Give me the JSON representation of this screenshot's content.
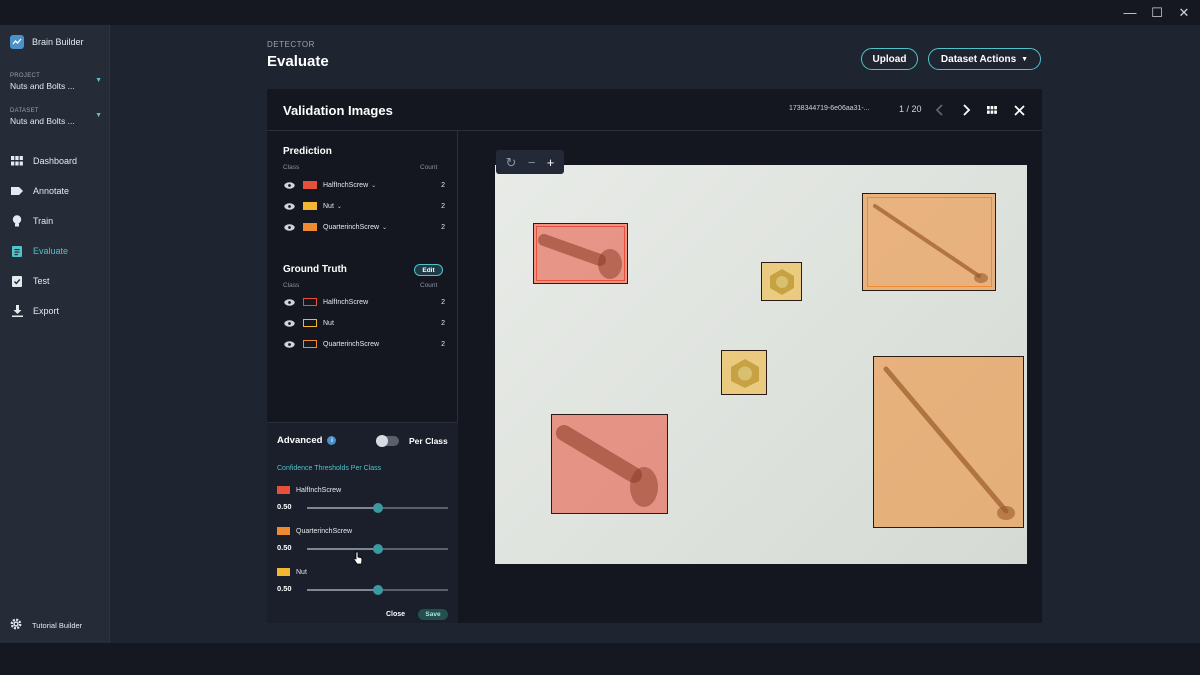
{
  "window": {
    "minimize": "—",
    "maximize": "☐",
    "close": "✕"
  },
  "app": {
    "name": "Brain Builder"
  },
  "project": {
    "label": "PROJECT",
    "value": "Nuts and Bolts ..."
  },
  "dataset": {
    "label": "DATASET",
    "value": "Nuts and Bolts ..."
  },
  "nav": [
    {
      "label": "Dashboard",
      "icon": "grid-icon"
    },
    {
      "label": "Annotate",
      "icon": "tag-icon"
    },
    {
      "label": "Train",
      "icon": "lightbulb-icon"
    },
    {
      "label": "Evaluate",
      "icon": "clipboard-icon",
      "active": true
    },
    {
      "label": "Test",
      "icon": "clipboard-check-icon"
    },
    {
      "label": "Export",
      "icon": "download-icon"
    }
  ],
  "footer": {
    "tutorial_label": "Tutorial Builder"
  },
  "header": {
    "subtitle": "DETECTOR",
    "title": "Evaluate",
    "upload_label": "Upload",
    "dataset_actions_label": "Dataset Actions"
  },
  "panel": {
    "title": "Validation Images",
    "image_id": "1738344719-6e06aa31-...",
    "pager": "1 / 20"
  },
  "prediction": {
    "title": "Prediction",
    "col_class": "Class",
    "col_count": "Count",
    "rows": [
      {
        "label": "HalfInchScrew",
        "count": "2",
        "color": "#e8503a"
      },
      {
        "label": "Nut",
        "count": "2",
        "color": "#f2b632"
      },
      {
        "label": "QuarterinchScrew",
        "count": "2",
        "color": "#f08a30"
      }
    ]
  },
  "ground_truth": {
    "title": "Ground Truth",
    "edit_label": "Edit",
    "col_class": "Class",
    "col_count": "Count",
    "rows": [
      {
        "label": "HalfInchScrew",
        "count": "2",
        "color": "#e8503a"
      },
      {
        "label": "Nut",
        "count": "2",
        "color": "#f2b632"
      },
      {
        "label": "QuarterinchScrew",
        "count": "2",
        "color": "#f08a30"
      }
    ]
  },
  "advanced": {
    "title": "Advanced",
    "per_class_label": "Per Class",
    "per_class_enabled": false,
    "thresholds_title": "Confidence Thresholds Per Class",
    "thresholds": [
      {
        "label": "HalfInchScrew",
        "value": "0.50",
        "fraction": 0.5,
        "color": "#e8503a"
      },
      {
        "label": "QuarterinchScrew",
        "value": "0.50",
        "fraction": 0.5,
        "color": "#f08a30"
      },
      {
        "label": "Nut",
        "value": "0.50",
        "fraction": 0.5,
        "color": "#f2b632"
      }
    ],
    "close_label": "Close",
    "save_label": "Save"
  },
  "colors": {
    "accent": "#4fc3c9",
    "halfinch": "#e8503a",
    "quarterinch": "#f08a30",
    "nut": "#f2b632"
  }
}
